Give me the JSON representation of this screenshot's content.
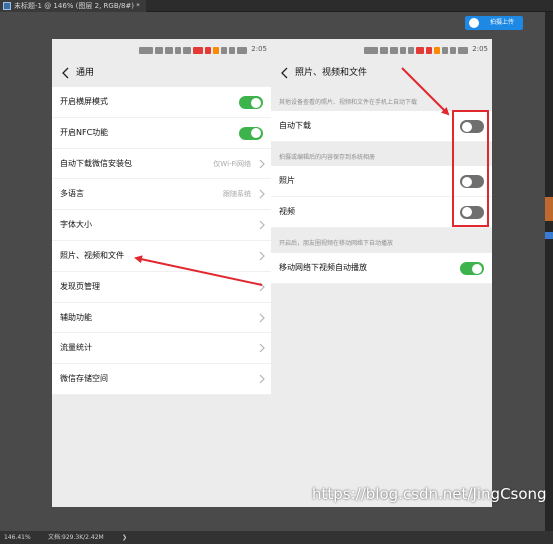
{
  "ps": {
    "tab_title": "未标题-1 @ 146% (图层 2, RGB/8#) *",
    "upload_label": "拍摄上传",
    "zoom": "146.41%",
    "doc_info": "文档:929.3K/2.42M",
    "status_arrow": "❯"
  },
  "left_phone": {
    "status_time": "2:05",
    "title": "通用",
    "items": [
      {
        "label": "开启横屏模式",
        "value": "",
        "type": "toggle",
        "state": "on"
      },
      {
        "label": "开启NFC功能",
        "value": "",
        "type": "toggle",
        "state": "on"
      },
      {
        "label": "自动下载微信安装包",
        "value": "仅Wi-Fi网络",
        "type": "chevron"
      },
      {
        "label": "多语言",
        "value": "跟随系统",
        "type": "chevron"
      },
      {
        "label": "字体大小",
        "value": "",
        "type": "chevron"
      },
      {
        "label": "照片、视频和文件",
        "value": "",
        "type": "chevron"
      },
      {
        "label": "发现页管理",
        "value": "",
        "type": "chevron"
      },
      {
        "label": "辅助功能",
        "value": "",
        "type": "chevron"
      },
      {
        "label": "流量统计",
        "value": "",
        "type": "chevron"
      },
      {
        "label": "微信存储空间",
        "value": "",
        "type": "chevron"
      }
    ]
  },
  "right_phone": {
    "status_time": "2:05",
    "title": "照片、视频和文件",
    "note1": "其他设备查看的照片、视频和文件在手机上自动下载",
    "auto_download_label": "自动下载",
    "auto_download_state": "off",
    "note2": "拍摄或编辑后的内容保存到系统相册",
    "photo_label": "照片",
    "photo_state": "off",
    "video_label": "视频",
    "video_state": "off",
    "note3": "开启后，朋友圈视频在移动网络下自动播放",
    "autoplay_label": "移动网络下视频自动播放",
    "autoplay_state": "on"
  },
  "watermark": "https://blog.csdn.net/JingCsong",
  "colors": {
    "toggle_on": "#3cb44b",
    "toggle_off": "#6f6f6f",
    "annotation_red": "#e0282e",
    "upload_blue": "#1e88e5"
  }
}
